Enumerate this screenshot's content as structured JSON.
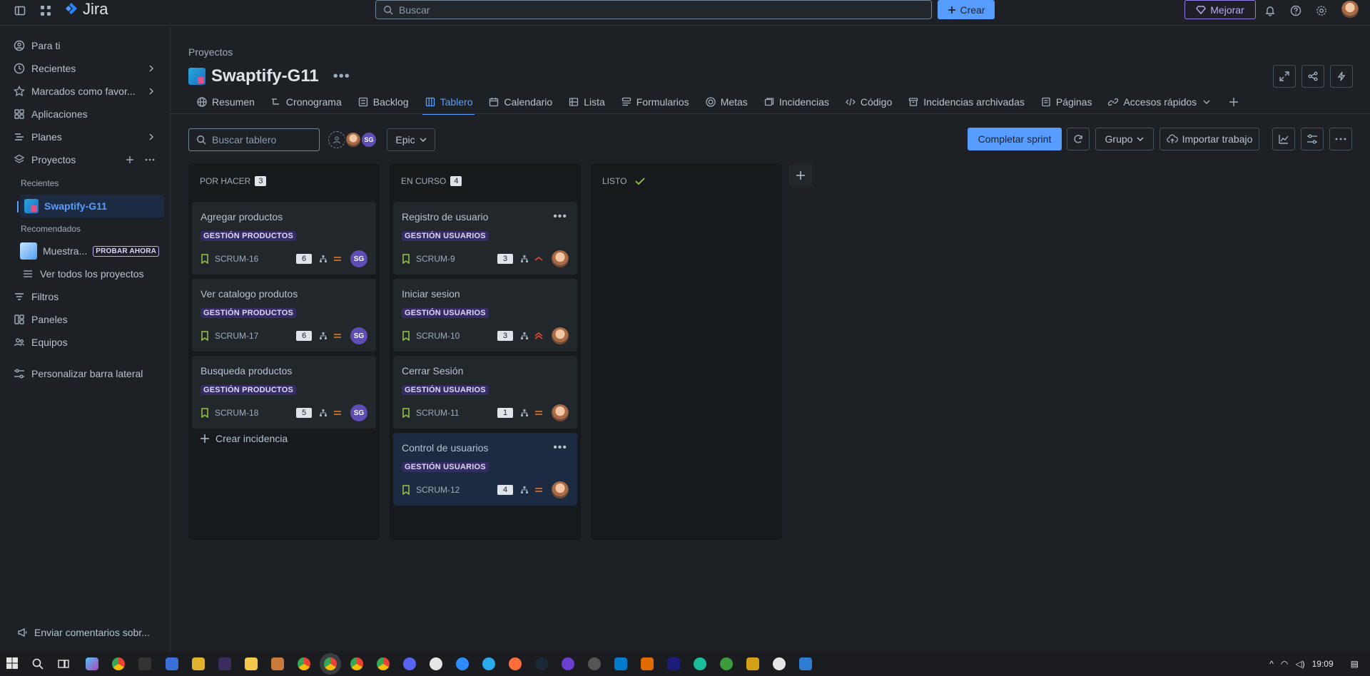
{
  "topbar": {
    "app_name": "Jira",
    "search_placeholder": "Buscar",
    "create_label": "Crear",
    "upgrade_label": "Mejorar"
  },
  "sidebar": {
    "for_you": "Para ti",
    "recent": "Recientes",
    "starred": "Marcados como favor...",
    "apps": "Aplicaciones",
    "plans": "Planes",
    "projects": "Proyectos",
    "recent_sub": "Recientes",
    "active_project": "Swaptify-G11",
    "recommended_sub": "Recomendados",
    "sample_project": "Muestra...",
    "try_now": "PROBAR AHORA",
    "view_all": "Ver todos los proyectos",
    "filters": "Filtros",
    "dashboards": "Paneles",
    "teams": "Equipos",
    "customize": "Personalizar barra lateral",
    "feedback": "Enviar comentarios sobr..."
  },
  "header": {
    "breadcrumb": "Proyectos",
    "project_name": "Swaptify-G11"
  },
  "tabs": [
    {
      "label": "Resumen",
      "icon": "globe-icon"
    },
    {
      "label": "Cronograma",
      "icon": "timeline-icon"
    },
    {
      "label": "Backlog",
      "icon": "backlog-icon"
    },
    {
      "label": "Tablero",
      "icon": "board-icon",
      "active": true
    },
    {
      "label": "Calendario",
      "icon": "calendar-icon"
    },
    {
      "label": "Lista",
      "icon": "list-icon"
    },
    {
      "label": "Formularios",
      "icon": "forms-icon"
    },
    {
      "label": "Metas",
      "icon": "target-icon"
    },
    {
      "label": "Incidencias",
      "icon": "issues-icon"
    },
    {
      "label": "Código",
      "icon": "code-icon"
    },
    {
      "label": "Incidencias archivadas",
      "icon": "archive-icon"
    },
    {
      "label": "Páginas",
      "icon": "pages-icon"
    },
    {
      "label": "Accesos rápidos",
      "icon": "link-icon"
    }
  ],
  "toolbar": {
    "search_placeholder": "Buscar tablero",
    "avatar_initials": "SG",
    "epic_label": "Epic",
    "complete_sprint": "Completar sprint",
    "group_label": "Grupo",
    "import_label": "Importar trabajo"
  },
  "columns": [
    {
      "title": "POR HACER",
      "count": "3",
      "cards": [
        {
          "title": "Agregar productos",
          "epic": "GESTIÓN PRODUCTOS",
          "key": "SCRUM-16",
          "points": "6",
          "priority": "medium",
          "assignee": "SG"
        },
        {
          "title": "Ver catalogo produtos",
          "epic": "GESTIÓN PRODUCTOS",
          "key": "SCRUM-17",
          "points": "6",
          "priority": "medium",
          "assignee": "SG"
        },
        {
          "title": "Busqueda productos",
          "epic": "GESTIÓN PRODUCTOS",
          "key": "SCRUM-18",
          "points": "5",
          "priority": "medium",
          "assignee": "SG"
        }
      ],
      "create_label": "Crear incidencia"
    },
    {
      "title": "EN CURSO",
      "count": "4",
      "cards": [
        {
          "title": "Registro de usuario",
          "epic": "GESTIÓN USUARIOS",
          "key": "SCRUM-9",
          "points": "3",
          "priority": "high",
          "assignee": "photo"
        },
        {
          "title": "Iniciar sesion",
          "epic": "GESTIÓN USUARIOS",
          "key": "SCRUM-10",
          "points": "3",
          "priority": "highest",
          "assignee": "photo"
        },
        {
          "title": "Cerrar Sesión",
          "epic": "GESTIÓN USUARIOS",
          "key": "SCRUM-11",
          "points": "1",
          "priority": "medium",
          "assignee": "photo"
        },
        {
          "title": "Control de usuarios",
          "epic": "GESTIÓN USUARIOS",
          "key": "SCRUM-12",
          "points": "4",
          "priority": "medium",
          "assignee": "photo"
        }
      ]
    },
    {
      "title": "LISTO",
      "count": "",
      "cards": []
    }
  ],
  "taskbar": {
    "time": "19:09"
  },
  "colors": {
    "accent": "#579dff",
    "epic_bg": "#352c63",
    "priority_medium": "#e2762a",
    "priority_high": "#e34935",
    "done_check": "#94c748"
  }
}
